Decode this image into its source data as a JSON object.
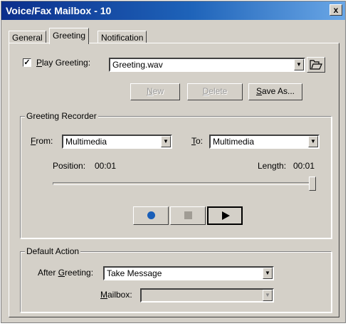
{
  "window": {
    "title": "Voice/Fax Mailbox - 10",
    "close_glyph": "x"
  },
  "tabs": [
    {
      "label": "General"
    },
    {
      "label": "Greeting",
      "active": true
    },
    {
      "label": "Notification"
    }
  ],
  "greeting": {
    "play_checked": true,
    "play_label_u": "P",
    "play_label_rest": "lay Greeting:",
    "file_value": "Greeting.wav",
    "new_label_u": "N",
    "new_label_rest": "ew",
    "delete_label_u": "D",
    "delete_label_rest": "elete",
    "saveas_label_u": "S",
    "saveas_label_rest": "ave As..."
  },
  "recorder": {
    "group_title": "Greeting Recorder",
    "from_label_u": "F",
    "from_label_rest": "rom:",
    "from_value": "Multimedia",
    "to_label_u": "T",
    "to_label_rest": "o:",
    "to_value": "Multimedia",
    "position_label": "Position:",
    "position_value": "00:01",
    "length_label": "Length:",
    "length_value": "00:01",
    "slider_fraction": 1.0
  },
  "default_action": {
    "group_title": "Default Action",
    "after_label_pre": "After ",
    "after_label_u": "G",
    "after_label_rest": "reeting:",
    "after_value": "Take Message",
    "mailbox_label_u": "M",
    "mailbox_label_rest": "ailbox:",
    "mailbox_value": ""
  },
  "icons": {
    "record": "record-icon",
    "stop": "stop-icon",
    "play": "play-icon",
    "folder": "folder-open-icon",
    "dropdown": "chevron-down-icon"
  }
}
